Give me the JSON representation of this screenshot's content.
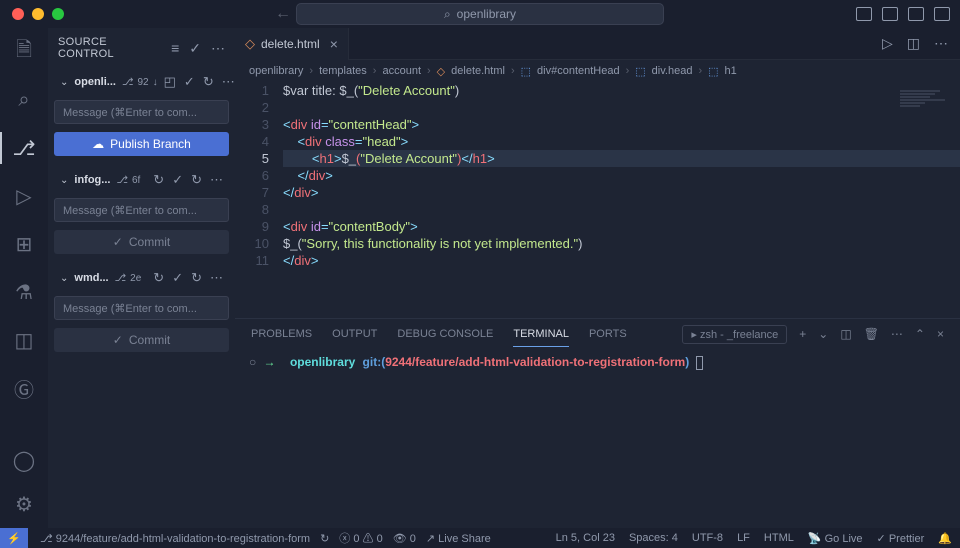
{
  "titlebar": {
    "search_text": "openlibrary"
  },
  "sidebar": {
    "title": "SOURCE CONTROL",
    "message_placeholder": "Message (⌘Enter to com...",
    "publish_label": "Publish Branch",
    "commit_label": "Commit",
    "repos": [
      {
        "name": "openli...",
        "badge_text": "92",
        "badge_icon": "branch"
      },
      {
        "name": "infog...",
        "badge_text": "6f",
        "badge_icon": "branch"
      },
      {
        "name": "wmd...",
        "badge_text": "2e",
        "badge_icon": "branch"
      }
    ]
  },
  "tabs": {
    "active_tab_label": "delete.html"
  },
  "breadcrumbs": {
    "items": [
      "openlibrary",
      "templates",
      "account",
      "delete.html",
      "div#contentHead",
      "div.head",
      "h1"
    ]
  },
  "code": {
    "lines": [
      {
        "n": 1,
        "tokens": [
          {
            "t": "$var title: $_(",
            "c": "txt"
          },
          {
            "t": "\"Delete Account\"",
            "c": "str"
          },
          {
            "t": ")",
            "c": "txt"
          }
        ]
      },
      {
        "n": 2,
        "tokens": []
      },
      {
        "n": 3,
        "tokens": [
          {
            "t": "<",
            "c": "punc"
          },
          {
            "t": "div",
            "c": "tag"
          },
          {
            "t": " id",
            "c": "attr"
          },
          {
            "t": "=",
            "c": "punc"
          },
          {
            "t": "\"contentHead\"",
            "c": "str"
          },
          {
            "t": ">",
            "c": "punc"
          }
        ]
      },
      {
        "n": 4,
        "tokens": [
          {
            "t": "    ",
            "c": "txt"
          },
          {
            "t": "<",
            "c": "punc"
          },
          {
            "t": "div",
            "c": "tag"
          },
          {
            "t": " class",
            "c": "attr"
          },
          {
            "t": "=",
            "c": "punc"
          },
          {
            "t": "\"head\"",
            "c": "str"
          },
          {
            "t": ">",
            "c": "punc"
          }
        ]
      },
      {
        "n": 5,
        "highlight": true,
        "tokens": [
          {
            "t": "        ",
            "c": "txt"
          },
          {
            "t": "<",
            "c": "punc"
          },
          {
            "t": "h1",
            "c": "tag"
          },
          {
            "t": ">",
            "c": "punc"
          },
          {
            "t": "$_",
            "c": "txt"
          },
          {
            "t": "(",
            "c": "bracket-err"
          },
          {
            "t": "\"Delete Account\"",
            "c": "str"
          },
          {
            "t": ")",
            "c": "bracket-err"
          },
          {
            "t": "</",
            "c": "punc"
          },
          {
            "t": "h1",
            "c": "tag"
          },
          {
            "t": ">",
            "c": "punc"
          }
        ]
      },
      {
        "n": 6,
        "tokens": [
          {
            "t": "    ",
            "c": "txt"
          },
          {
            "t": "</",
            "c": "punc"
          },
          {
            "t": "div",
            "c": "tag"
          },
          {
            "t": ">",
            "c": "punc"
          }
        ]
      },
      {
        "n": 7,
        "tokens": [
          {
            "t": "</",
            "c": "punc"
          },
          {
            "t": "div",
            "c": "tag"
          },
          {
            "t": ">",
            "c": "punc"
          }
        ]
      },
      {
        "n": 8,
        "tokens": []
      },
      {
        "n": 9,
        "tokens": [
          {
            "t": "<",
            "c": "punc"
          },
          {
            "t": "div",
            "c": "tag"
          },
          {
            "t": " id",
            "c": "attr"
          },
          {
            "t": "=",
            "c": "punc"
          },
          {
            "t": "\"contentBody\"",
            "c": "str"
          },
          {
            "t": ">",
            "c": "punc"
          }
        ]
      },
      {
        "n": 10,
        "tokens": [
          {
            "t": "$_(",
            "c": "txt"
          },
          {
            "t": "\"Sorry, this functionality is not yet implemented.\"",
            "c": "str"
          },
          {
            "t": ")",
            "c": "txt"
          }
        ]
      },
      {
        "n": 11,
        "tokens": [
          {
            "t": "</",
            "c": "punc"
          },
          {
            "t": "div",
            "c": "tag"
          },
          {
            "t": ">",
            "c": "punc"
          }
        ]
      }
    ]
  },
  "panel": {
    "tabs": [
      "PROBLEMS",
      "OUTPUT",
      "DEBUG CONSOLE",
      "TERMINAL",
      "PORTS"
    ],
    "active_tab": "TERMINAL",
    "terminal_label": "zsh - _freelance",
    "terminal_line": {
      "project": "openlibrary",
      "git_label": "git:(",
      "branch": "9244/feature/add-html-validation-to-registration-form",
      "close": ")"
    }
  },
  "statusbar": {
    "branch": "9244/feature/add-html-validation-to-registration-form",
    "errors": "0",
    "warnings": "0",
    "hints": "0",
    "live_share": "Live Share",
    "cursor": "Ln 5, Col 23",
    "spaces": "Spaces: 4",
    "encoding": "UTF-8",
    "eol": "LF",
    "language": "HTML",
    "go_live": "Go Live",
    "prettier": "Prettier"
  }
}
